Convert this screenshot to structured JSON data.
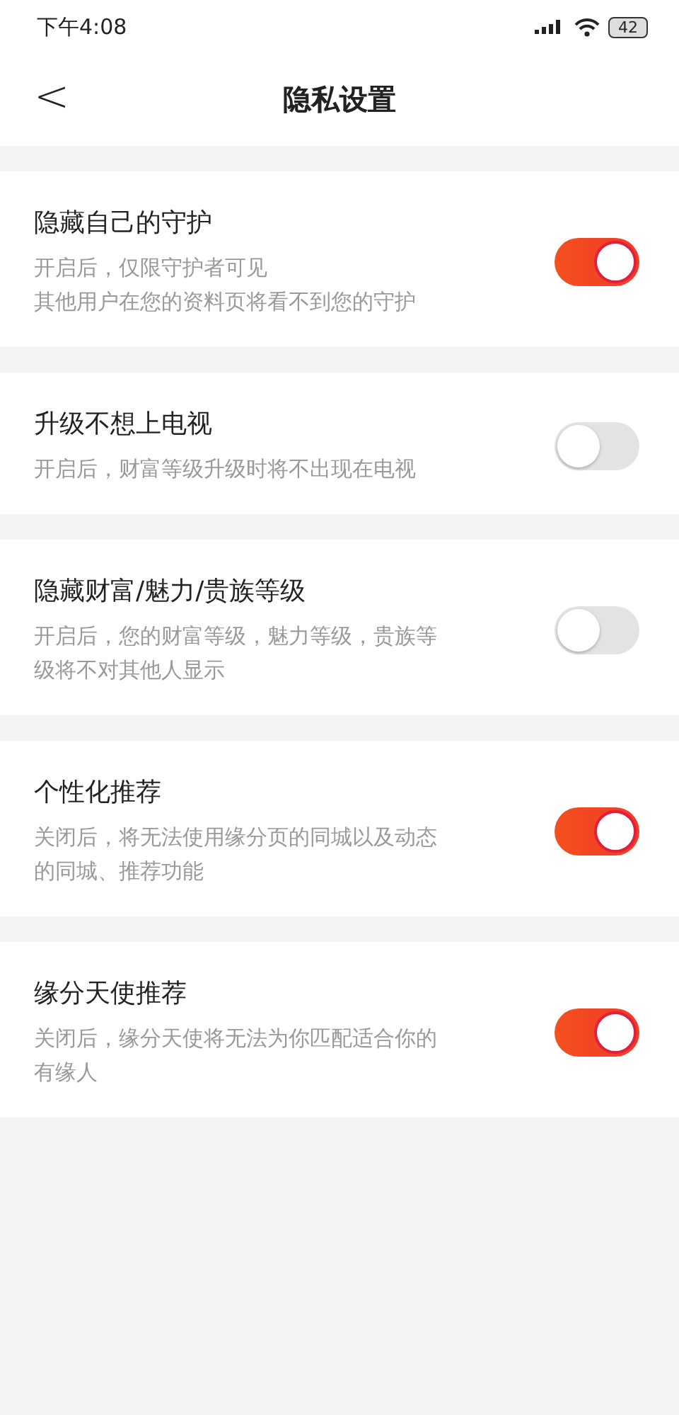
{
  "status_bar": {
    "time": "下午4:08",
    "battery": "42"
  },
  "header": {
    "back": "<",
    "title": "隐私设置"
  },
  "settings": [
    {
      "title": "隐藏自己的守护",
      "lines": [
        "开启后，仅限守护者可见",
        "其他用户在您的资料页将看不到您的守护"
      ],
      "on": true
    },
    {
      "title": "升级不想上电视",
      "lines": [
        "开启后，财富等级升级时将不出现在电视"
      ],
      "on": false
    },
    {
      "title": "隐藏财富/魅力/贵族等级",
      "lines": [
        "开启后，您的财富等级，魅力等级，贵族等",
        "级将不对其他人显示"
      ],
      "on": false
    },
    {
      "title": "个性化推荐",
      "lines": [
        "关闭后，将无法使用缘分页的同城以及动态",
        "的同城、推荐功能"
      ],
      "on": true
    },
    {
      "title": "缘分天使推荐",
      "lines": [
        "关闭后，缘分天使将无法为你匹配适合你的",
        "有缘人"
      ],
      "on": true
    }
  ]
}
